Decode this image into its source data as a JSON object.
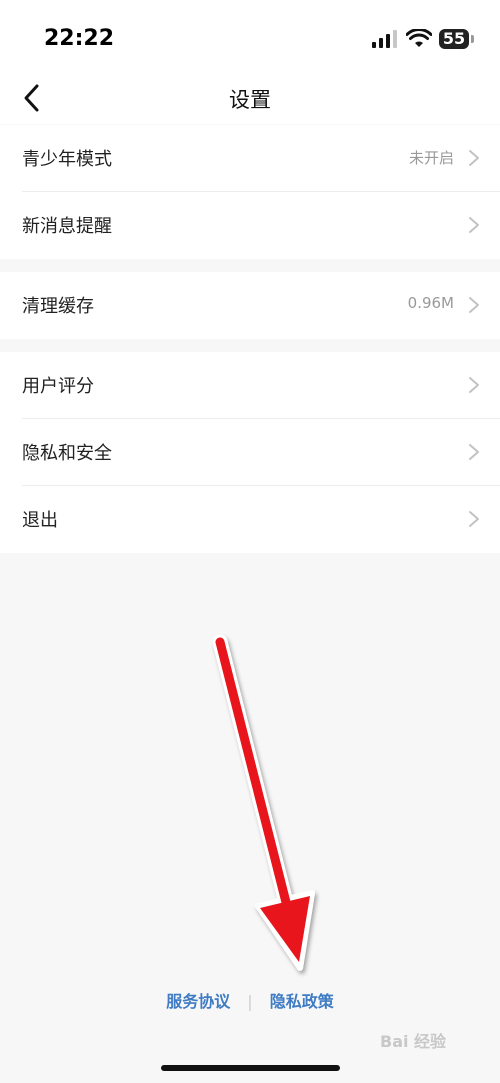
{
  "status_bar": {
    "time": "22:22",
    "battery": "55"
  },
  "header": {
    "title": "设置",
    "back_icon": "chevron-left-icon"
  },
  "groups": [
    {
      "items": [
        {
          "label": "青少年模式",
          "value": "未开启"
        },
        {
          "label": "新消息提醒",
          "value": ""
        }
      ]
    },
    {
      "items": [
        {
          "label": "清理缓存",
          "value": "0.96M"
        }
      ]
    },
    {
      "items": [
        {
          "label": "用户评分",
          "value": ""
        },
        {
          "label": "隐私和安全",
          "value": ""
        },
        {
          "label": "退出",
          "value": ""
        }
      ]
    }
  ],
  "footer": {
    "service_link": "服务协议",
    "separator": "|",
    "privacy_link": "隐私政策"
  },
  "annotation": {
    "arrow_color": "#e8141b"
  },
  "watermark": {
    "text": "Bai 经验"
  }
}
